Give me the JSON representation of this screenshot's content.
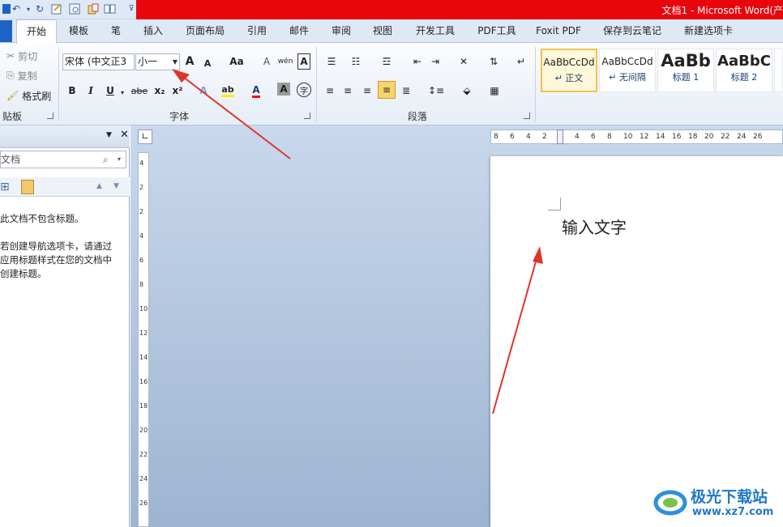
{
  "window": {
    "title": "文档1 - Microsoft Word(产"
  },
  "tabs": [
    {
      "label": "开始"
    },
    {
      "label": "模板"
    },
    {
      "label": "笔"
    },
    {
      "label": "插入"
    },
    {
      "label": "页面布局"
    },
    {
      "label": "引用"
    },
    {
      "label": "邮件"
    },
    {
      "label": "审阅"
    },
    {
      "label": "视图"
    },
    {
      "label": "开发工具"
    },
    {
      "label": "PDF工具"
    },
    {
      "label": "Foxit PDF"
    },
    {
      "label": "保存到云笔记"
    },
    {
      "label": "新建选项卡"
    }
  ],
  "clipboard": {
    "cut": "剪切",
    "copy": "复制",
    "format_painter": "格式刷",
    "group_label": "贴板"
  },
  "font": {
    "name_value": "宋体 (中文正3",
    "size_value": "小一",
    "grow": "A",
    "shrink": "A",
    "change_case": "Aa",
    "clear_format": "A",
    "phonetic": "wén",
    "char_border": "A",
    "bold": "B",
    "italic": "I",
    "underline": "U",
    "strike": "abe",
    "subscript": "x₂",
    "superscript": "x²",
    "font_color": "A",
    "char_shading": "A",
    "enclosed": "字",
    "group_label": "字体"
  },
  "paragraph": {
    "group_label": "段落"
  },
  "styles": [
    {
      "sample": "AaBbCcDd",
      "name": "↵ 正文"
    },
    {
      "sample": "AaBbCcDd",
      "name": "↵ 无间隔"
    },
    {
      "sample": "AaBb",
      "name": "标题 1"
    },
    {
      "sample": "AaBbC",
      "name": "标题 2"
    }
  ],
  "nav": {
    "search_placeholder": "文档",
    "line1": "此文档不包含标题。",
    "line2": "若创建导航选项卡，请通过",
    "line3": "应用标题样式在您的文档中",
    "line4": "创建标题。"
  },
  "document": {
    "text": "输入文字"
  },
  "ruler": {
    "h_ticks": [
      "8",
      "6",
      "4",
      "2",
      "2",
      "4",
      "6",
      "8",
      "10",
      "12",
      "14",
      "16",
      "18",
      "20",
      "22",
      "24",
      "26"
    ],
    "v_ticks": [
      "4",
      "2",
      "2",
      "4",
      "6",
      "8",
      "10",
      "12",
      "14",
      "16",
      "18",
      "20",
      "22",
      "24",
      "26"
    ]
  },
  "watermark": {
    "brand": "极光下载站",
    "url": "www.xz7.com"
  },
  "colors": {
    "accent_red": "#e8060c",
    "arrow": "#e0332b",
    "file_blue": "#1d62c4"
  }
}
